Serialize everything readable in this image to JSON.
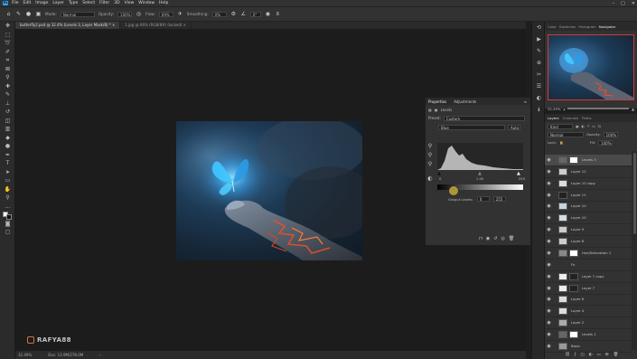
{
  "menubar": {
    "logo": "Ps",
    "items": [
      "File",
      "Edit",
      "Image",
      "Layer",
      "Type",
      "Select",
      "Filter",
      "3D",
      "View",
      "Window",
      "Help"
    ],
    "window_controls": [
      "–",
      "□",
      "✕"
    ]
  },
  "options": {
    "mode_label": "Mode:",
    "mode_value": "Normal",
    "opacity_label": "Opacity:",
    "opacity_value": "100%",
    "flow_label": "Flow:",
    "flow_value": "69%",
    "smoothing_label": "Smoothing:",
    "smoothing_value": "0%",
    "angle_value": "0°"
  },
  "tabs": [
    {
      "label": "butterfly2.psd @ 32.4% (Levels 3, Layer Mask/8) * ×",
      "active": true
    },
    {
      "label": "1.jpg @ 66% (RGB/8#) (locked) ×",
      "active": false
    }
  ],
  "canvas": {
    "background": "#1c1c1c"
  },
  "status": {
    "zoom": "32.49%",
    "doc": "Doc: 13.9M/278.0M",
    "arrow": "›"
  },
  "watermark": {
    "text": "RAFYA88"
  },
  "properties": {
    "tabs": [
      "Properties",
      "Adjustments"
    ],
    "title": "Levels",
    "preset_label": "Preset:",
    "preset_value": "Custom",
    "channel_value": "Blue",
    "auto_label": "Auto",
    "input_values": [
      "0",
      "1.00",
      "255"
    ],
    "output_label": "Output Levels:",
    "output_values": [
      "0",
      "255"
    ]
  },
  "navigator": {
    "tabs": [
      "Color",
      "Swatches",
      "Histogram",
      "Navigator"
    ],
    "zoom": "32.49%"
  },
  "layers": {
    "tabs": [
      "Layers",
      "Channels",
      "Paths"
    ],
    "kind_label": "Kind",
    "blend_value": "Normal",
    "opacity_label": "Opacity:",
    "opacity_value": "100%",
    "lock_label": "Lock:",
    "fill_label": "Fill:",
    "fill_value": "100%",
    "rows": [
      {
        "name": "Levels 3",
        "selected": true
      },
      {
        "name": "Layer 12",
        "selected": false
      },
      {
        "name": "Layer 10 copy",
        "selected": false
      },
      {
        "name": "Layer 11",
        "selected": false
      },
      {
        "name": "Layer 10",
        "selected": false
      },
      {
        "name": "Layer 10",
        "selected": false
      },
      {
        "name": "Layer 9",
        "selected": false
      },
      {
        "name": "Layer 8",
        "selected": false
      },
      {
        "name": "Hue/Saturation 1",
        "selected": false
      },
      {
        "name": "Fx",
        "selected": false
      },
      {
        "name": "Layer 7 copy",
        "selected": false
      },
      {
        "name": "Layer 7",
        "selected": false
      },
      {
        "name": "Layer 6",
        "selected": false
      },
      {
        "name": "Layer 4",
        "selected": false
      },
      {
        "name": "Layer 2",
        "selected": false
      },
      {
        "name": "Levels 1",
        "selected": false
      },
      {
        "name": "Basic",
        "selected": false
      }
    ]
  },
  "colors": {
    "accent": "#2fa3f7",
    "fire": "#e0502a",
    "nav_frame": "#d23a3a"
  }
}
